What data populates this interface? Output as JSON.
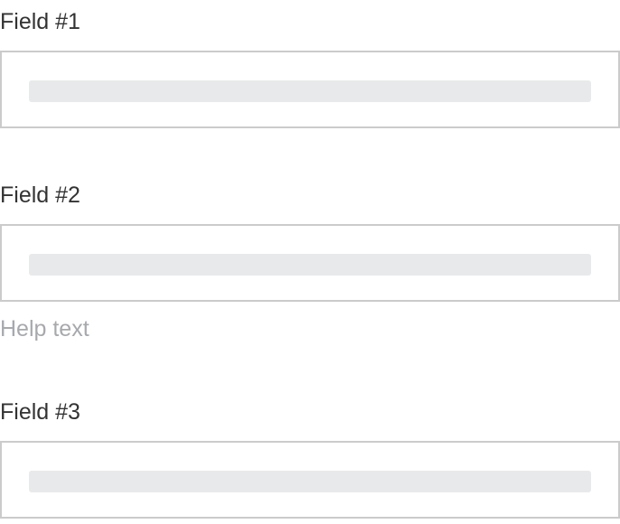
{
  "fields": [
    {
      "label": "Field #1"
    },
    {
      "label": "Field #2",
      "help_text": "Help text"
    },
    {
      "label": "Field #3"
    }
  ],
  "colors": {
    "label": "#333333",
    "help_text": "#a7a9ad",
    "border": "#cbcbcb",
    "placeholder": "#e8e9ea"
  }
}
